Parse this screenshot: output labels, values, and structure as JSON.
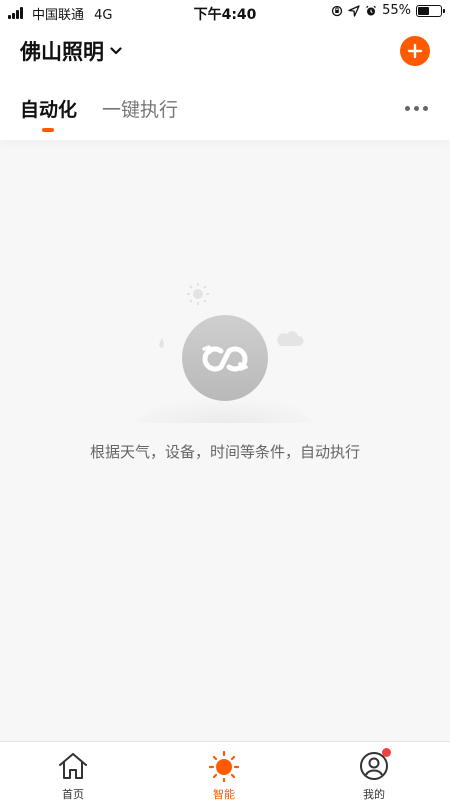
{
  "status_bar": {
    "carrier": "中国联通",
    "network": "4G",
    "time": "下午4:40",
    "battery_percent": "55%",
    "battery_level": 0.55
  },
  "header": {
    "home_name": "佛山照明",
    "chevron_icon": "chevron-down-icon",
    "add_icon": "plus-icon"
  },
  "tabs": [
    {
      "label": "自动化",
      "active": true
    },
    {
      "label": "一键执行",
      "active": false
    }
  ],
  "empty_state": {
    "icon": "automation-loop-icon",
    "text": "根据天气，设备，时间等条件，自动执行"
  },
  "tab_bar": {
    "items": [
      {
        "label": "首页",
        "icon": "home-icon",
        "active": false
      },
      {
        "label": "智能",
        "icon": "sun-icon",
        "active": true
      },
      {
        "label": "我的",
        "icon": "user-icon",
        "active": false,
        "badge": true
      }
    ]
  },
  "colors": {
    "accent": "#ff5a00",
    "badge": "#f04040",
    "text_primary": "#111111",
    "text_secondary": "#777777",
    "background": "#f7f7f7"
  }
}
